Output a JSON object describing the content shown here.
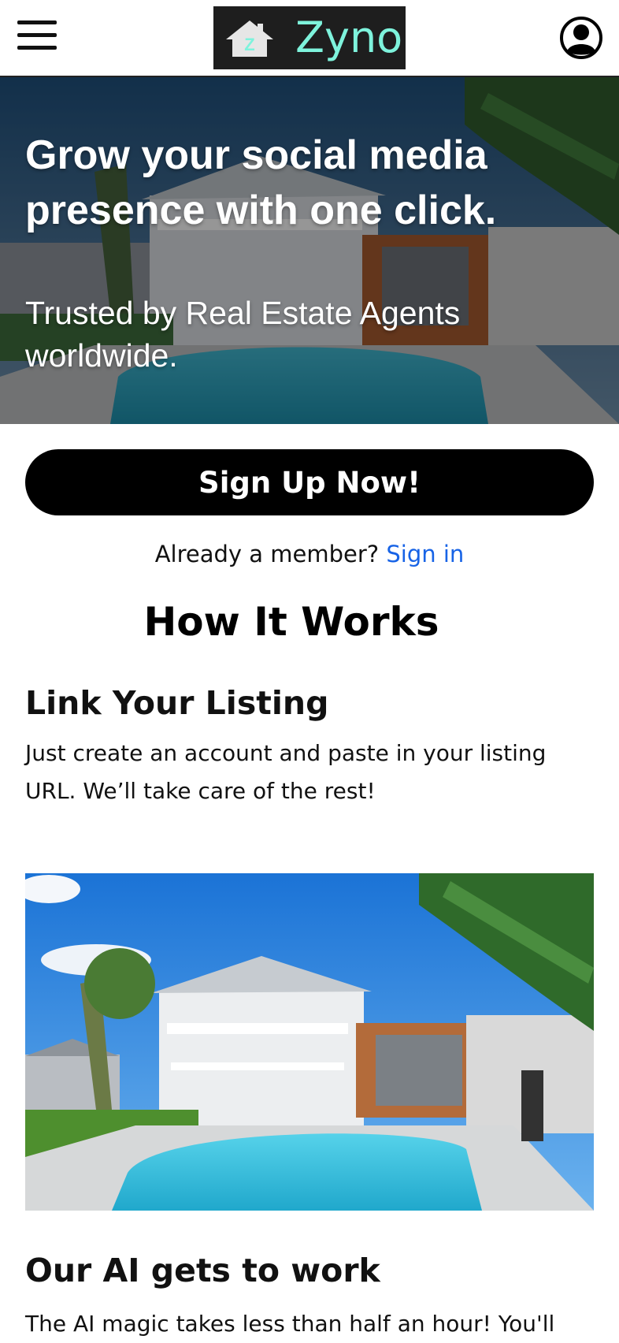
{
  "header": {
    "menu_icon": "hamburger-menu-icon",
    "logo_text": "Zyno",
    "logo_icon": "house-icon",
    "logo_icon_letter": "Z",
    "account_icon": "user-account-icon",
    "brand_color": "#7ef3dc"
  },
  "hero": {
    "title": "Grow your social media presence with one click.",
    "subtitle": "Trusted by Real Estate Agents worldwide."
  },
  "cta": {
    "signup_label": "Sign Up Now!",
    "member_prompt": "Already a member?",
    "signin_label": "Sign in",
    "link_color": "#1763e6"
  },
  "how": {
    "title": "How It Works",
    "steps": [
      {
        "title": "Link Your Listing",
        "description": "Just create an account and paste in your listing URL. We’ll take care of the rest!"
      },
      {
        "title": "Our AI gets to work",
        "description": "The AI magic takes less than half an hour! You'll"
      }
    ]
  }
}
